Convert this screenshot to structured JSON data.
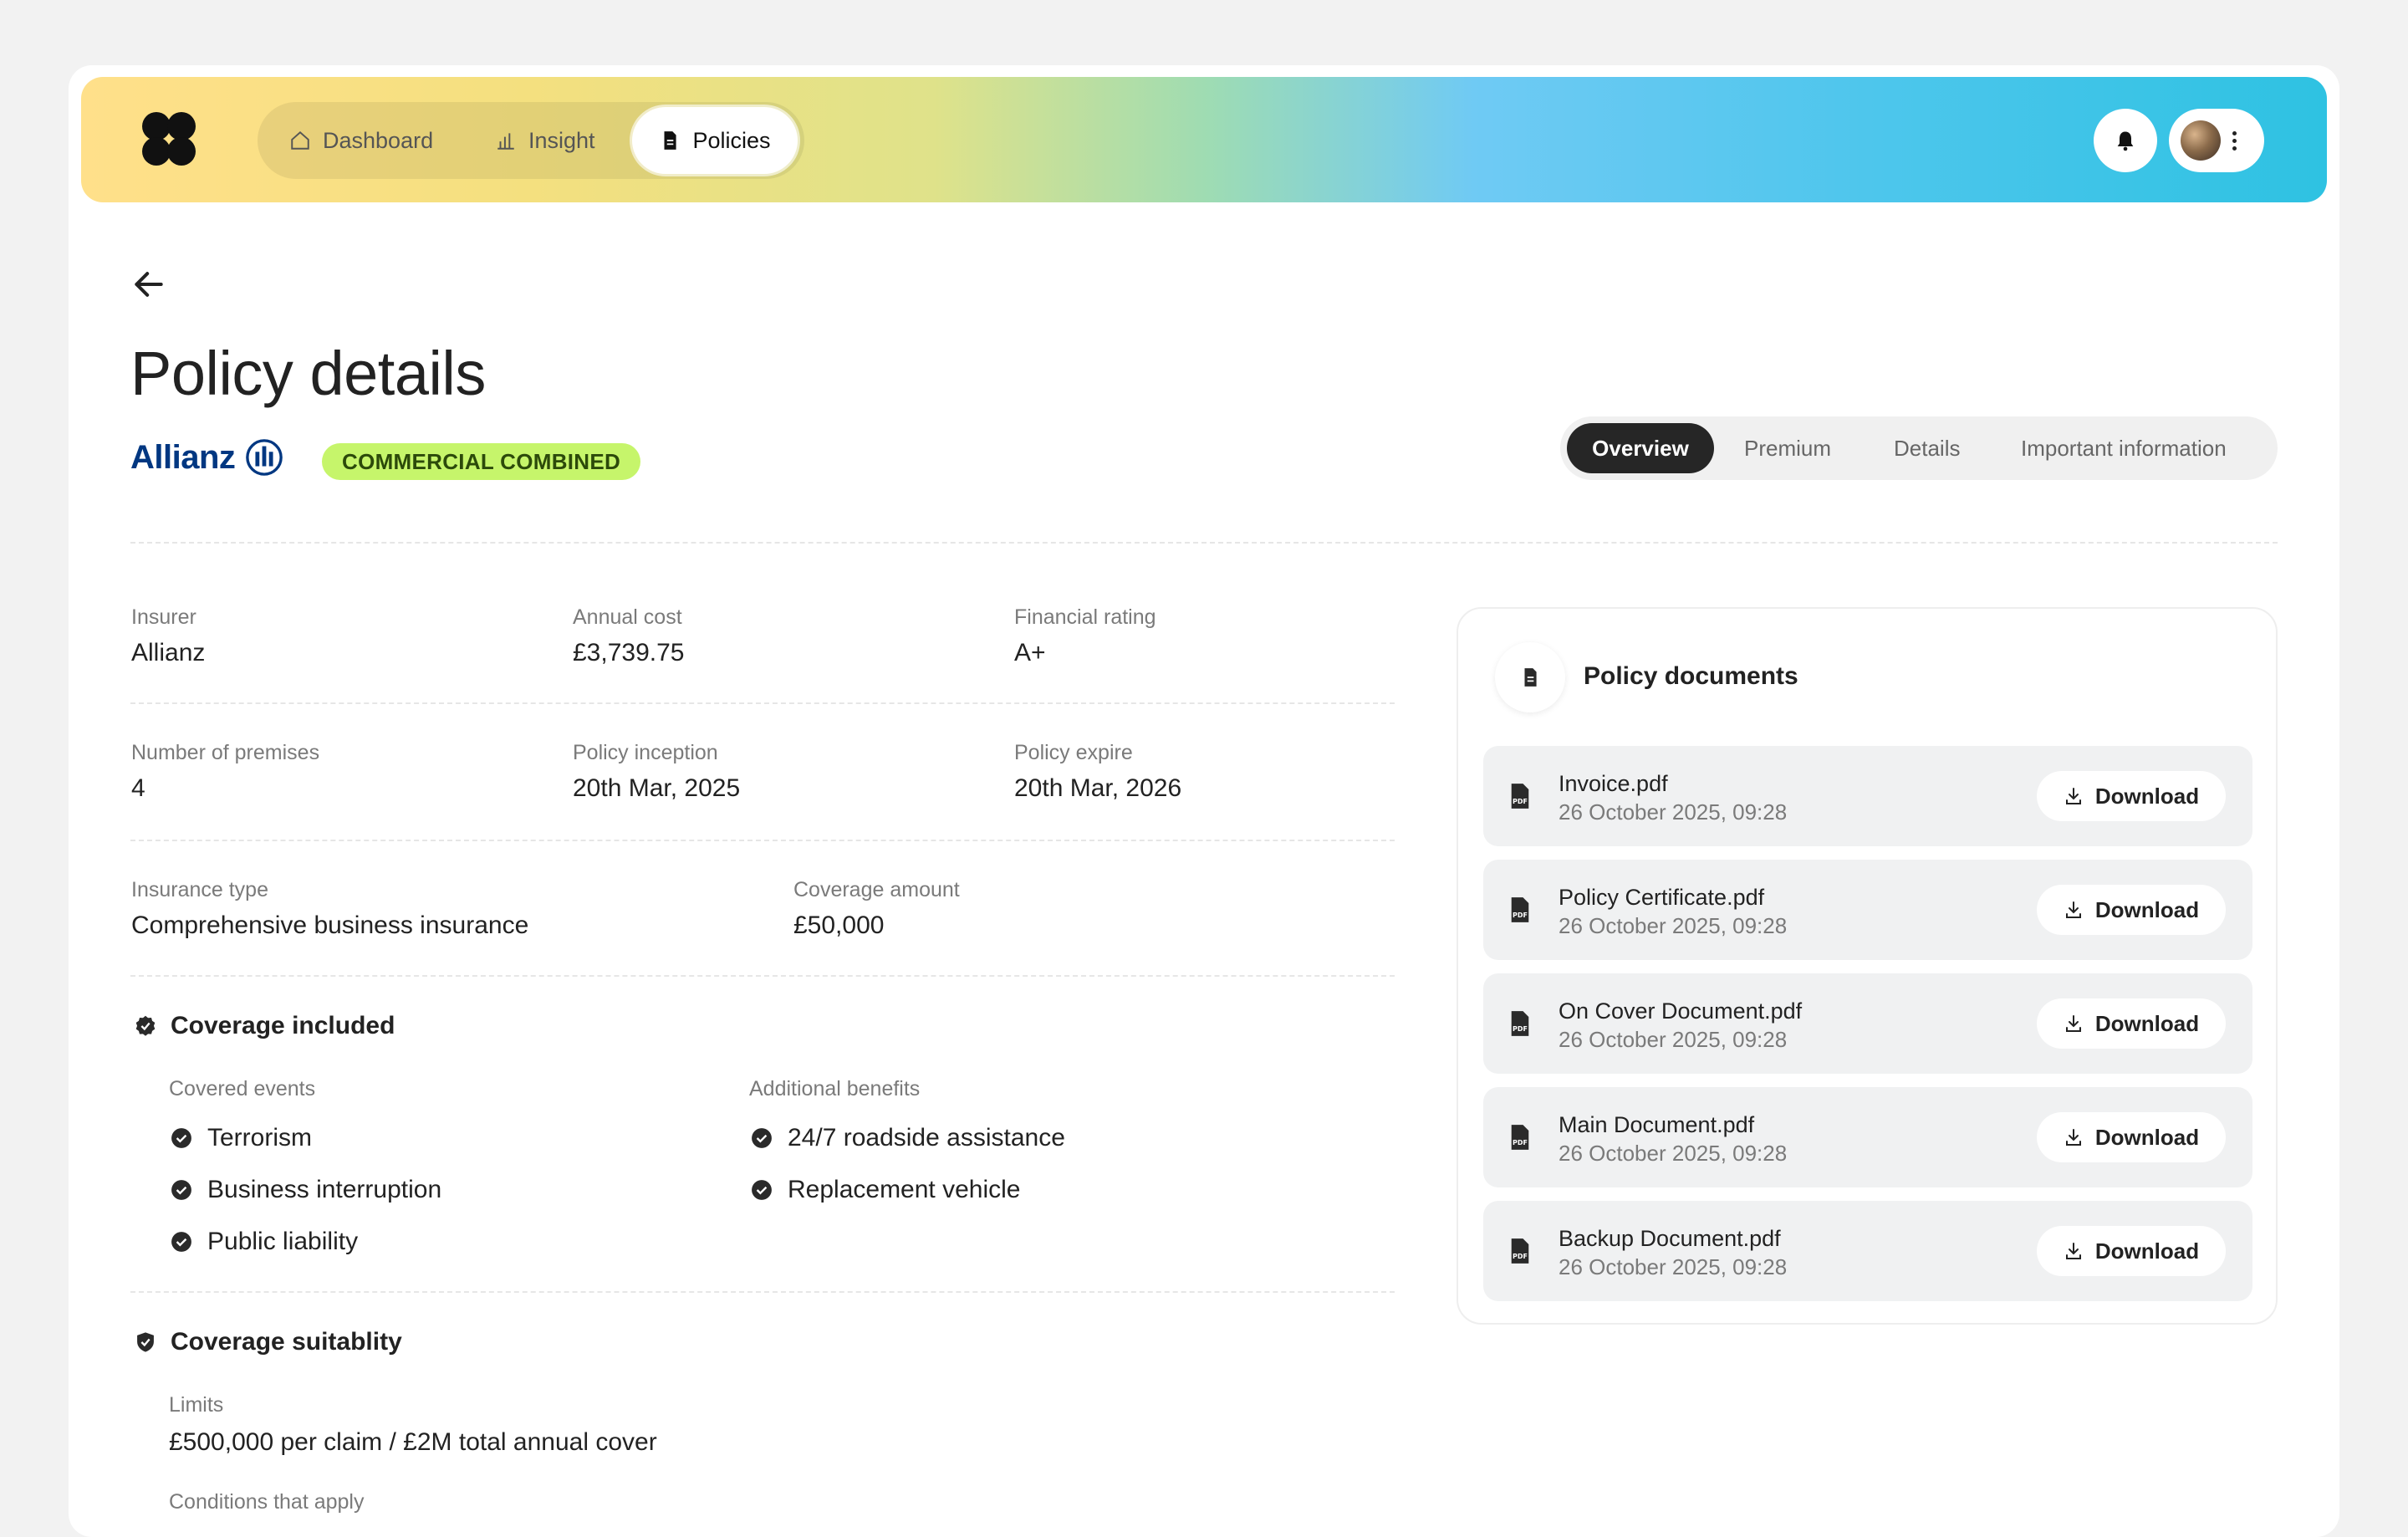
{
  "nav": {
    "items": [
      {
        "label": "Dashboard",
        "icon": "home-icon"
      },
      {
        "label": "Insight",
        "icon": "bar-chart-icon"
      },
      {
        "label": "Policies",
        "icon": "document-icon"
      }
    ],
    "active": "Policies"
  },
  "page": {
    "title": "Policy details",
    "insurer_brand": "Allianz",
    "badge": "COMMERCIAL COMBINED"
  },
  "tabs": [
    "Overview",
    "Premium",
    "Details",
    "Important information"
  ],
  "info": {
    "insurer": {
      "label": "Insurer",
      "value": "Allianz"
    },
    "annual_cost": {
      "label": "Annual cost",
      "value": "£3,739.75"
    },
    "financial_rating": {
      "label": "Financial rating",
      "value": "A+"
    },
    "premises": {
      "label": "Number of premises",
      "value": "4"
    },
    "inception": {
      "label": "Policy inception",
      "value": "20th Mar, 2025"
    },
    "expire": {
      "label": "Policy expire",
      "value": "20th Mar, 2026"
    },
    "insurance_type": {
      "label": "Insurance type",
      "value": "Comprehensive business insurance"
    },
    "coverage_amount": {
      "label": "Coverage amount",
      "value": "£50,000"
    }
  },
  "coverage": {
    "title": "Coverage included",
    "covered_events_label": "Covered events",
    "covered_events": [
      "Terrorism",
      "Business interruption",
      "Public liability"
    ],
    "benefits_label": "Additional benefits",
    "benefits": [
      "24/7 roadside assistance",
      "Replacement vehicle"
    ]
  },
  "suitability": {
    "title": "Coverage suitablity",
    "limits_label": "Limits",
    "limits_value": "£500,000 per claim / £2M total annual cover",
    "conditions_label": "Conditions that apply"
  },
  "documents": {
    "title": "Policy documents",
    "download_label": "Download",
    "items": [
      {
        "name": "Invoice.pdf",
        "date": "26 October 2025, 09:28"
      },
      {
        "name": "Policy Certificate.pdf",
        "date": "26 October 2025, 09:28"
      },
      {
        "name": "On Cover Document.pdf",
        "date": "26 October 2025, 09:28"
      },
      {
        "name": "Main Document.pdf",
        "date": "26 October 2025, 09:28"
      },
      {
        "name": "Backup Document.pdf",
        "date": "26 October 2025, 09:28"
      }
    ]
  },
  "colors": {
    "badge_bg": "#c6f56b",
    "brand_blue": "#003781",
    "active_tab": "#262626"
  }
}
